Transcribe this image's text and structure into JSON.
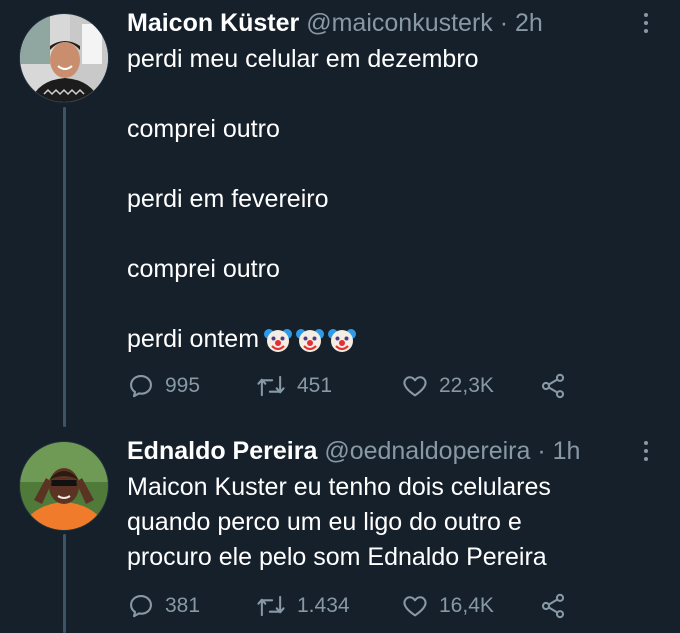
{
  "tweets": [
    {
      "name": "Maicon Küster",
      "meta": "@maiconkusterk · 2h",
      "lines": [
        "perdi meu celular em dezembro",
        "",
        "comprei outro",
        "",
        "perdi em fevereiro",
        "",
        "comprei outro",
        "",
        "perdi ontem"
      ],
      "trailing_emoji": [
        "clown-face",
        "clown-face",
        "clown-face"
      ],
      "actions": {
        "replies": "995",
        "retweets": "451",
        "likes": "22,3K"
      }
    },
    {
      "name": "Ednaldo Pereira",
      "meta": "@oednaldopereira · 1h",
      "lines": [
        "Maicon Kuster eu tenho  dois celulares",
        "quando  perco  um eu ligo  do outro  e",
        "procuro  ele pelo som Ednaldo Pereira"
      ],
      "actions": {
        "replies": "381",
        "retweets": "1.434",
        "likes": "16,4K"
      }
    }
  ],
  "colors": {
    "background": "#15202b",
    "text": "#ffffff",
    "secondary": "#8899a6",
    "thread_line": "#3d5466"
  },
  "icons": [
    "reply-icon",
    "retweet-icon",
    "like-icon",
    "share-icon",
    "more-icon"
  ]
}
